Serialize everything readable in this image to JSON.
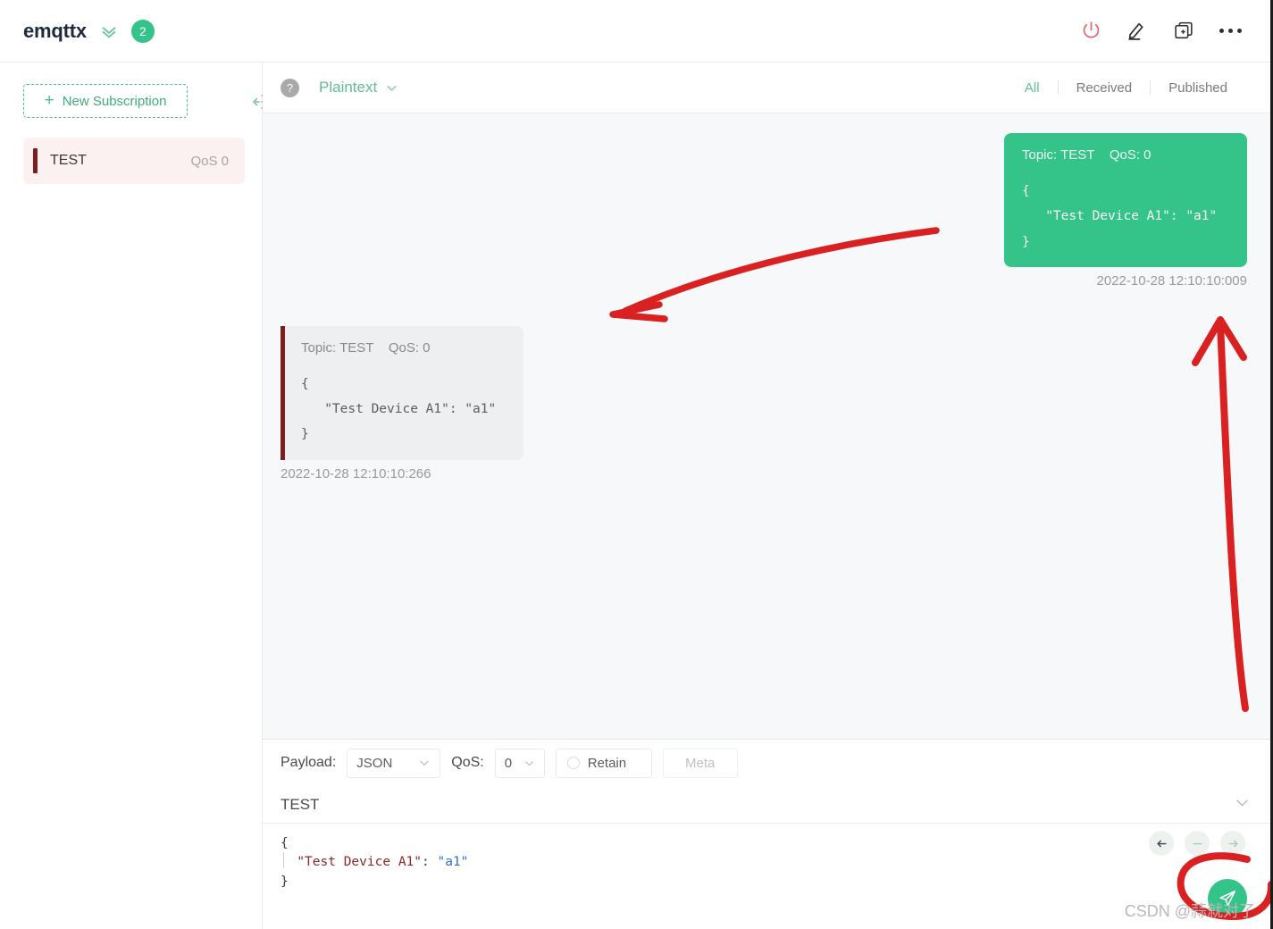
{
  "topbar": {
    "connection_name": "emqttx",
    "badge_count": "2",
    "icons": {
      "collapse": "chevron-double-down-icon",
      "power": "power-icon",
      "edit": "pencil-icon",
      "duplicate": "new-window-icon",
      "more": "ellipsis-icon"
    },
    "colors": {
      "accent_green": "#34c388",
      "power_red": "#e06a72"
    }
  },
  "sidebar": {
    "new_subscription_label": "New Subscription",
    "plus": "+",
    "subscriptions": [
      {
        "topic": "TEST",
        "qos": "QoS 0",
        "color": "#7c1f1f"
      }
    ]
  },
  "messages_header": {
    "help_glyph": "?",
    "format": "Plaintext",
    "filters": [
      {
        "label": "All",
        "active": true
      },
      {
        "label": "Received",
        "active": false
      },
      {
        "label": "Published",
        "active": false
      }
    ]
  },
  "messages": [
    {
      "direction": "published",
      "meta": "Topic: TEST    QoS: 0",
      "payload": "{\n   \"Test Device A1\": \"a1\"\n}",
      "timestamp": "2022-10-28 12:10:10:009"
    },
    {
      "direction": "received",
      "meta": "Topic: TEST    QoS: 0",
      "payload": "{\n   \"Test Device A1\": \"a1\"\n}",
      "timestamp": "2022-10-28 12:10:10:266"
    }
  ],
  "publish": {
    "payload_label": "Payload:",
    "payload_format": "JSON",
    "qos_label": "QoS:",
    "qos_value": "0",
    "retain_label": "Retain",
    "retain_checked": false,
    "meta_label": "Meta",
    "topic": "TEST",
    "editor": {
      "line1": "{",
      "key": "\"Test Device A1\"",
      "colon": ": ",
      "value": "\"a1\"",
      "line3": "}"
    },
    "nav": {
      "back": "arrow-left-icon",
      "minus": "minus-icon",
      "forward": "arrow-right-icon"
    },
    "send": "send-icon"
  },
  "watermark": "CSDN @蒜就对了"
}
